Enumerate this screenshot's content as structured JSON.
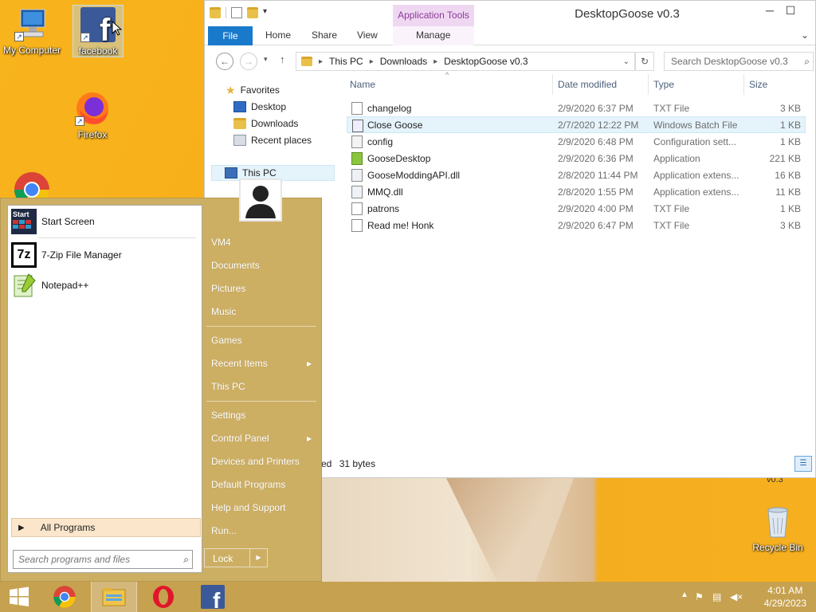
{
  "desktop": {
    "icons": [
      {
        "label": "My Computer"
      },
      {
        "label": "facebook"
      },
      {
        "label": "Firefox"
      },
      {
        "label": "Recycle Bin"
      }
    ],
    "partial_label": "v0.3"
  },
  "explorer": {
    "title": "DesktopGoose v0.3",
    "contextual_tab_group": "Application Tools",
    "ribbon_tabs": [
      "File",
      "Home",
      "Share",
      "View",
      "Manage"
    ],
    "breadcrumb": [
      "This PC",
      "Downloads",
      "DesktopGoose v0.3"
    ],
    "search_placeholder": "Search DesktopGoose v0.3",
    "nav": {
      "favorites": "Favorites",
      "desktop": "Desktop",
      "downloads": "Downloads",
      "recent": "Recent places",
      "this_pc": "This PC"
    },
    "columns": [
      "Name",
      "Date modified",
      "Type",
      "Size"
    ],
    "files": [
      {
        "name": "changelog",
        "date": "2/9/2020 6:37 PM",
        "type": "TXT File",
        "size": "3 KB"
      },
      {
        "name": "Close Goose",
        "date": "2/7/2020 12:22 PM",
        "type": "Windows Batch File",
        "size": "1 KB"
      },
      {
        "name": "config",
        "date": "2/9/2020 6:48 PM",
        "type": "Configuration sett...",
        "size": "1 KB"
      },
      {
        "name": "GooseDesktop",
        "date": "2/9/2020 6:36 PM",
        "type": "Application",
        "size": "221 KB"
      },
      {
        "name": "GooseModdingAPI.dll",
        "date": "2/8/2020 11:44 PM",
        "type": "Application extens...",
        "size": "16 KB"
      },
      {
        "name": "MMQ.dll",
        "date": "2/8/2020 1:55 PM",
        "type": "Application extens...",
        "size": "11 KB"
      },
      {
        "name": "patrons",
        "date": "2/9/2020 4:00 PM",
        "type": "TXT File",
        "size": "1 KB"
      },
      {
        "name": "Read me! Honk",
        "date": "2/9/2020 6:47 PM",
        "type": "TXT File",
        "size": "3 KB"
      }
    ],
    "status_partial": "ed",
    "status_size": "31 bytes"
  },
  "start_menu": {
    "programs": [
      "Start Screen",
      "7-Zip File Manager",
      "Notepad++"
    ],
    "program_icon_text": [
      "Start",
      "7z"
    ],
    "all_programs": "All Programs",
    "search_placeholder": "Search programs and files",
    "right_items": [
      "VM4",
      "Documents",
      "Pictures",
      "Music",
      "Games",
      "Recent Items",
      "This PC",
      "Settings",
      "Control Panel",
      "Devices and Printers",
      "Default Programs",
      "Help and Support",
      "Run..."
    ],
    "lock_label": "Lock"
  },
  "taskbar": {
    "time": "4:01 AM",
    "date": "4/29/2023"
  }
}
